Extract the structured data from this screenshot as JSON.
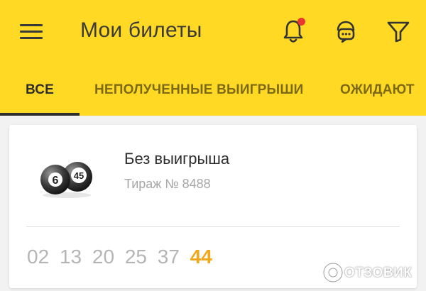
{
  "header": {
    "title": "Мои билеты",
    "icons": {
      "menu": "menu-icon",
      "notifications": "bell-icon",
      "support": "support-chat-icon",
      "filter": "filter-icon"
    },
    "has_notification_dot": true
  },
  "tabs": [
    {
      "label": "ВСЕ",
      "active": true
    },
    {
      "label": "НЕПОЛУЧЕННЫЕ ВЫИГРЫШИ",
      "active": false
    },
    {
      "label": "ОЖИДАЮТ",
      "active": false
    }
  ],
  "ticket": {
    "logo_numbers": [
      "6",
      "45"
    ],
    "status": "Без выигрыша",
    "draw": "Тираж № 8488",
    "numbers": [
      "02",
      "13",
      "20",
      "25",
      "37"
    ],
    "bonus_number": "44"
  },
  "watermark": {
    "text": "ОТЗОВИК"
  },
  "colors": {
    "appbar": "#ffd923",
    "accent_number": "#f2a81c",
    "notification_dot": "#e8382f"
  }
}
